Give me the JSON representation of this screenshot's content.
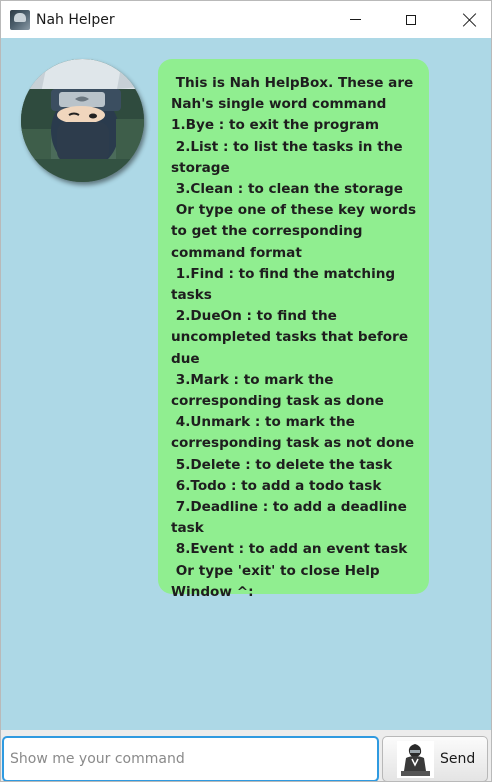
{
  "window": {
    "title": "Nah Helper",
    "icon": "app-logo-icon"
  },
  "window_controls": {
    "minimize_icon": "minimize-icon",
    "maximize_icon": "maximize-icon",
    "close_icon": "close-icon"
  },
  "chat": {
    "background": "#add8e6",
    "bubble_color": "#90ee90",
    "avatar": "ninja-avatar",
    "message": " This is Nah HelpBox. These are Nah's single word command 1.Bye : to exit the program\n 2.List : to list the tasks in the storage\n 3.Clean : to clean the storage\n Or type one of these key words to get the corresponding command format\n 1.Find : to find the matching tasks\n 2.DueOn : to find the uncompleted tasks that before due\n 3.Mark : to mark the corresponding task as done\n 4.Unmark : to mark the corresponding task as not done\n 5.Delete : to delete the task\n 6.Todo : to add a todo task\n 7.Deadline : to add a deadline task\n 8.Event : to add an event task\n Or type 'exit' to close Help Window ^:"
  },
  "input": {
    "placeholder": "Show me your command",
    "value": "",
    "focus_color": "#2f9ae0"
  },
  "send_button": {
    "label": "Send",
    "icon": "ninja-send-icon"
  }
}
